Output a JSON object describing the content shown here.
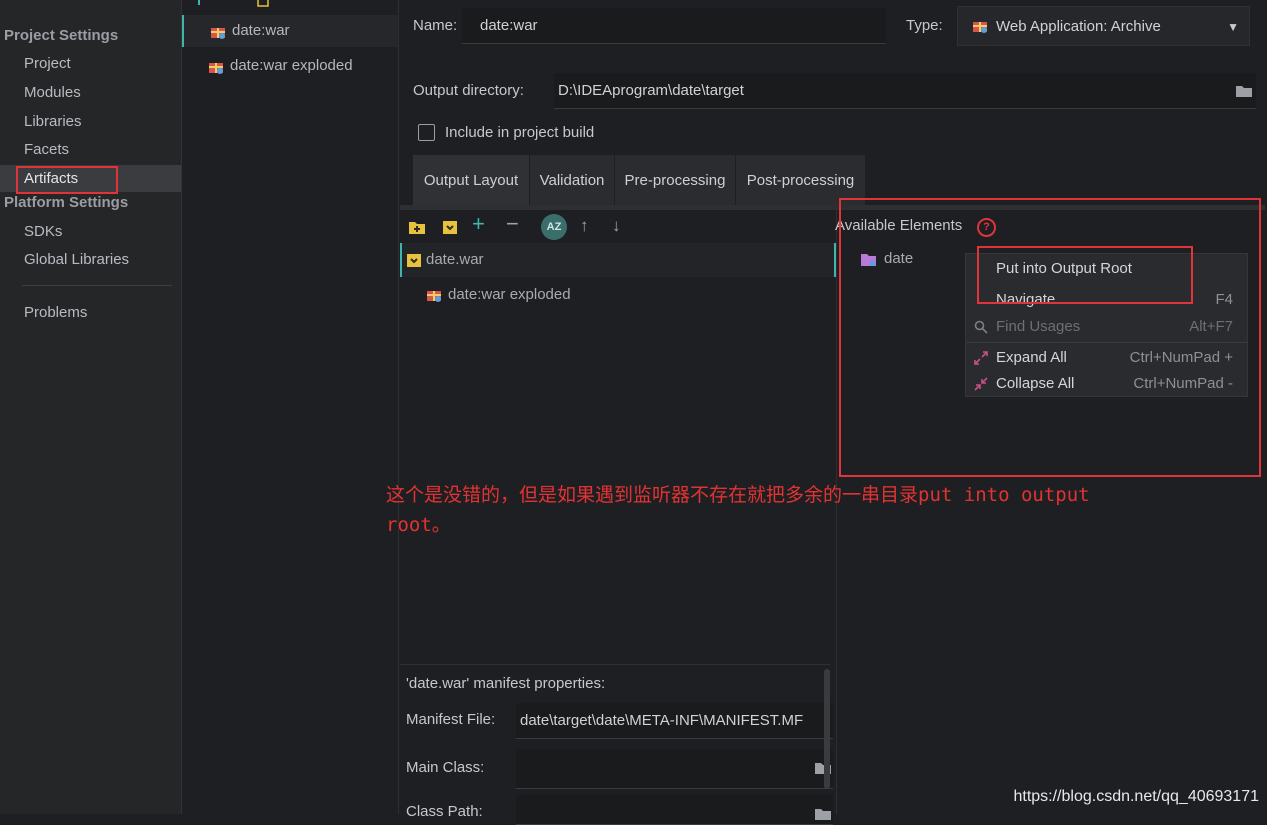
{
  "sidebar": {
    "project_settings_title": "Project Settings",
    "project_settings_items": [
      "Project",
      "Modules",
      "Libraries",
      "Facets",
      "Artifacts"
    ],
    "platform_settings_title": "Platform Settings",
    "platform_settings_items": [
      "SDKs",
      "Global Libraries"
    ],
    "problems_label": "Problems",
    "selected": "Artifacts"
  },
  "artifacts": {
    "items": [
      "date:war",
      "date:war exploded"
    ],
    "selected": "date:war"
  },
  "form": {
    "name_label": "Name:",
    "name_value": "date:war",
    "type_label": "Type:",
    "type_value": "Web Application: Archive",
    "output_dir_label": "Output directory:",
    "output_dir_value": "D:\\IDEAprogram\\date\\target",
    "include_build_label": "Include in project build",
    "include_build_checked": false
  },
  "tabs": [
    "Output Layout",
    "Validation",
    "Pre-processing",
    "Post-processing"
  ],
  "selected_tab": "Output Layout",
  "output_layout": {
    "toolbar_icons": [
      "new-folder-icon",
      "archive-icon",
      "add-icon",
      "remove-icon",
      "sort-az-icon",
      "move-up-icon",
      "move-down-icon"
    ],
    "tree": [
      {
        "label": "date.war",
        "icon": "archive-icon"
      },
      {
        "label": "date:war exploded",
        "icon": "artifact-icon"
      }
    ]
  },
  "available": {
    "title": "Available Elements",
    "help_icon": "help-icon",
    "tree": [
      {
        "label": "date",
        "icon": "module-folder-icon"
      }
    ]
  },
  "context_menu": {
    "items": [
      {
        "label": "Put into Output Root",
        "shortcut": ""
      },
      {
        "label": "Navigate",
        "shortcut": "F4"
      },
      {
        "label": "Find Usages",
        "shortcut": "Alt+F7",
        "disabled": true
      },
      {
        "label": "Expand All",
        "shortcut": "Ctrl+NumPad +"
      },
      {
        "label": "Collapse All",
        "shortcut": "Ctrl+NumPad -"
      }
    ]
  },
  "manifest": {
    "title": "'date.war' manifest properties:",
    "file_label": "Manifest File:",
    "file_value": "date\\target\\date\\META-INF\\MANIFEST.MF",
    "main_class_label": "Main Class:",
    "main_class_value": "",
    "class_path_label": "Class Path:"
  },
  "annotation": {
    "text_line1": "这个是没错的，但是如果遇到监听器不存在就把多余的一串目录put into output",
    "text_line2": "root。"
  },
  "watermark": "https://blog.csdn.net/qq_40693171",
  "colors": {
    "background": "#1e1f22",
    "sidebar": "#252628",
    "accent_teal": "#3fb5ac",
    "highlight_red": "#e0333a",
    "folder_yellow": "#e8c23a",
    "module_purple": "#b77ad6"
  }
}
